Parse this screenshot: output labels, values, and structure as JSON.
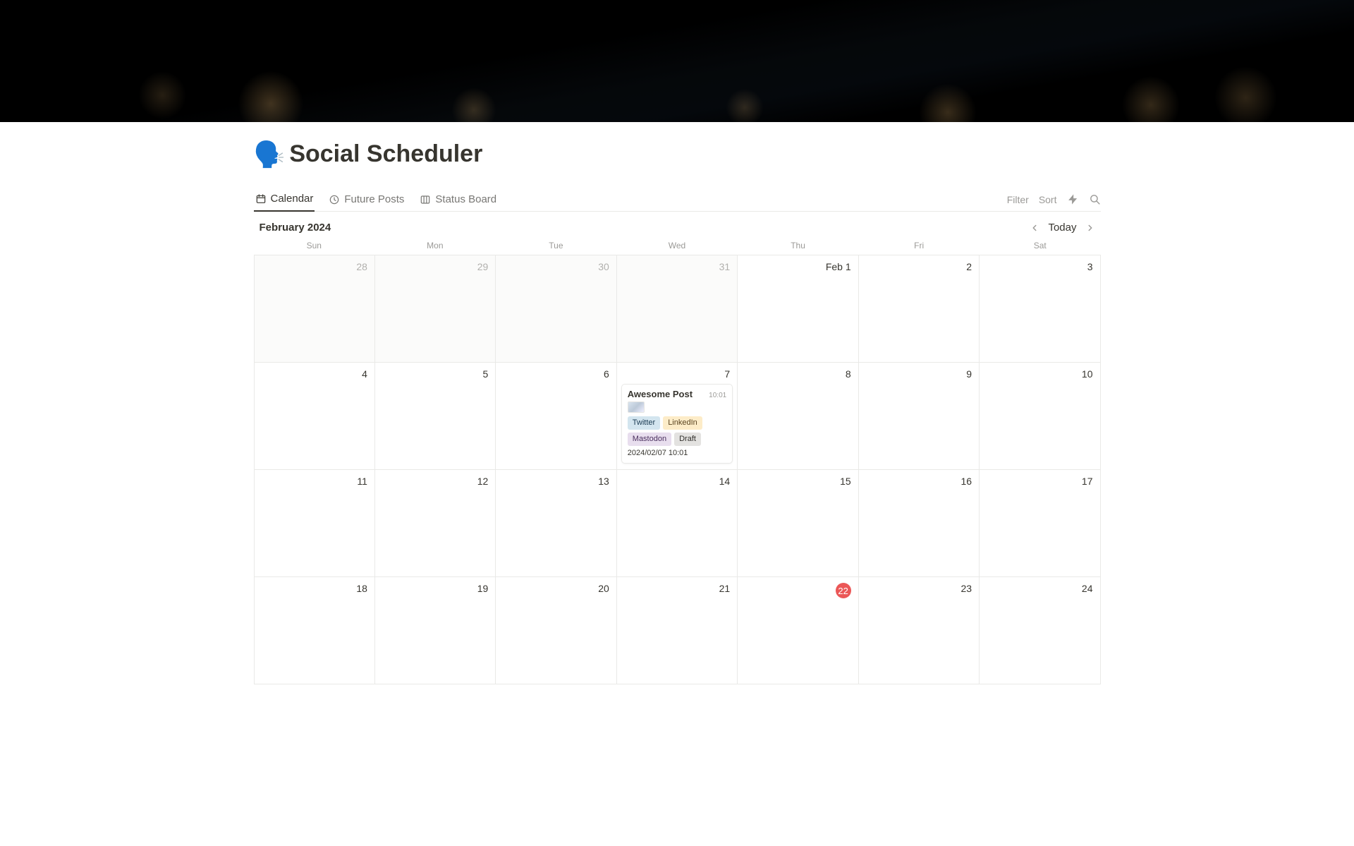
{
  "page": {
    "icon": "🗣️",
    "title": "Social Scheduler"
  },
  "tabs": [
    {
      "id": "calendar",
      "label": "Calendar",
      "icon": "calendar",
      "active": true
    },
    {
      "id": "future",
      "label": "Future Posts",
      "icon": "clock",
      "active": false
    },
    {
      "id": "status",
      "label": "Status Board",
      "icon": "board",
      "active": false
    }
  ],
  "toolbar": {
    "filter": "Filter",
    "sort": "Sort"
  },
  "calendar": {
    "month_label": "February 2024",
    "today_label": "Today",
    "dow": [
      "Sun",
      "Mon",
      "Tue",
      "Wed",
      "Thu",
      "Fri",
      "Sat"
    ],
    "weeks": [
      [
        {
          "n": "28",
          "other": true
        },
        {
          "n": "29",
          "other": true
        },
        {
          "n": "30",
          "other": true
        },
        {
          "n": "31",
          "other": true
        },
        {
          "n": "Feb 1",
          "month_start": true
        },
        {
          "n": "2"
        },
        {
          "n": "3"
        }
      ],
      [
        {
          "n": "4"
        },
        {
          "n": "5"
        },
        {
          "n": "6"
        },
        {
          "n": "7",
          "event": true
        },
        {
          "n": "8"
        },
        {
          "n": "9"
        },
        {
          "n": "10"
        }
      ],
      [
        {
          "n": "11"
        },
        {
          "n": "12"
        },
        {
          "n": "13"
        },
        {
          "n": "14"
        },
        {
          "n": "15"
        },
        {
          "n": "16"
        },
        {
          "n": "17"
        }
      ],
      [
        {
          "n": "18"
        },
        {
          "n": "19"
        },
        {
          "n": "20"
        },
        {
          "n": "21"
        },
        {
          "n": "22",
          "today": true
        },
        {
          "n": "23"
        },
        {
          "n": "24"
        }
      ]
    ]
  },
  "event": {
    "title": "Awesome Post",
    "time": "10:01",
    "tags": [
      {
        "label": "Twitter",
        "cls": "twitter"
      },
      {
        "label": "LinkedIn",
        "cls": "linkedin"
      },
      {
        "label": "Mastodon",
        "cls": "mastodon"
      },
      {
        "label": "Draft",
        "cls": "draft"
      }
    ],
    "datetime": "2024/02/07 10:01"
  }
}
